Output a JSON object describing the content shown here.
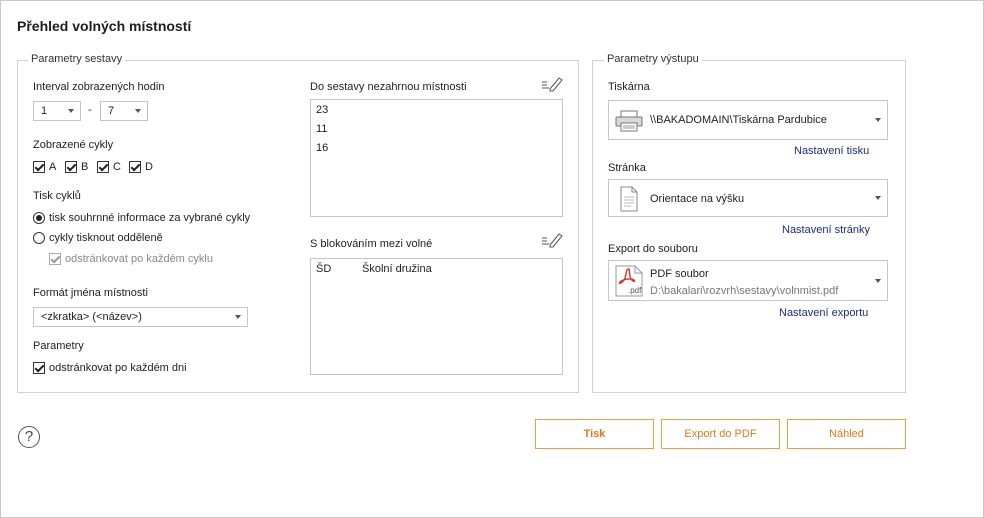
{
  "window": {
    "title": "Přehled volných místností"
  },
  "report_params": {
    "legend": "Parametry sestavy",
    "hours_label": "Interval zobrazených hodin",
    "hours_from": "1",
    "hours_sep": "-",
    "hours_to": "7",
    "cycles_label": "Zobrazené cykly",
    "cycles": [
      {
        "label": "A",
        "checked": true
      },
      {
        "label": "B",
        "checked": true
      },
      {
        "label": "C",
        "checked": true
      },
      {
        "label": "D",
        "checked": true
      }
    ],
    "print_cycles_label": "Tisk cyklů",
    "print_option_1": "tisk souhrnné informace za vybrané cykly",
    "print_option_2": "cykly tisknout odděleně",
    "page_break_cycle": "odstránkovat po každém cyklu",
    "room_format_label": "Formát jména místnosti",
    "room_format_value": "<zkratka> (<název>)",
    "params_label": "Parametry",
    "page_break_day": "odstránkovat po každém dni",
    "excluded_label": "Do sestavy nezahrnou místnosti",
    "excluded_rooms": [
      "23",
      "11",
      "16"
    ],
    "blocked_label": "S blokováním mezi volné",
    "blocked_rooms": [
      {
        "code": "ŠD",
        "name": "Školní družina"
      }
    ]
  },
  "output_params": {
    "legend": "Parametry výstupu",
    "printer_label": "Tiskárna",
    "printer_value": "\\\\BAKADOMAIN\\Tiskárna Pardubice",
    "printer_settings_link": "Nastavení tisku",
    "page_label": "Stránka",
    "page_value": "Orientace na výšku",
    "page_settings_link": "Nastavení stránky",
    "export_label": "Export do souboru",
    "export_value": "PDF soubor",
    "export_path": "D:\\bakalari\\rozvrh\\sestavy\\volnmist.pdf",
    "export_settings_link": "Nastavení exportu",
    "pdf_icon_text": ".pdf"
  },
  "buttons": {
    "help": "?",
    "print": "Tisk",
    "export_pdf": "Export do PDF",
    "preview": "Náhled"
  },
  "colors": {
    "accent": "#e07a1e",
    "link": "#1c2c7e",
    "pdf_red": "#d9342b"
  }
}
